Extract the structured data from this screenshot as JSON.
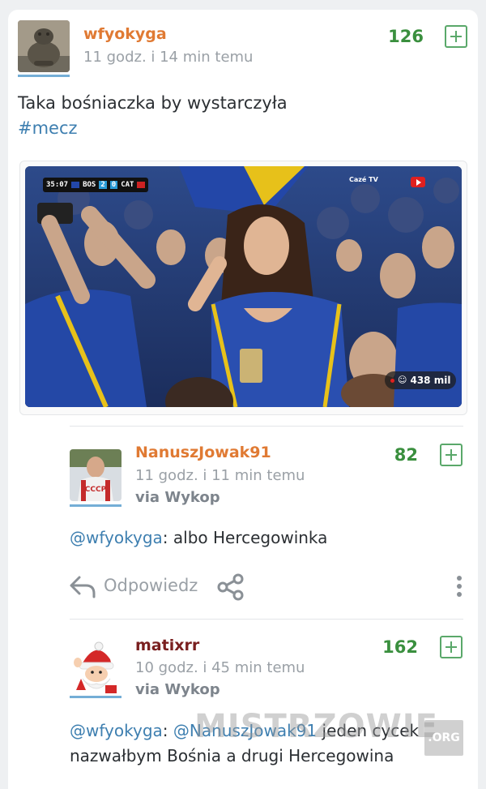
{
  "post": {
    "author": "wfyokyga",
    "time": "11 godz. i 14 min temu",
    "score": "126",
    "text": "Taka bośniaczka by wystarczyła",
    "tag": "#mecz",
    "media": {
      "scoreboard_time": "35:07",
      "team_home": "BOS",
      "score_home": "2",
      "score_away": "0",
      "team_away": "CAT",
      "broadcaster": "Cazé TV",
      "view_count": "438 mil"
    }
  },
  "comments": [
    {
      "author": "NanuszJowak91",
      "time": "11 godz. i 11 min temu",
      "via_label": "via",
      "via_app": "Wykop",
      "score": "82",
      "mention": "@wfyokyga",
      "text": ": albo Hercegowinka",
      "actions": {
        "reply_label": "Odpowiedz"
      }
    },
    {
      "author": "matixrr",
      "time": "10 godz. i 45 min temu",
      "via_label": "via",
      "via_app": "Wykop",
      "score": "162",
      "mention": "@wfyokyga",
      "text_part1": ": ",
      "mention2": "@NanuszJowak91",
      "text_part2": " jeden cycek",
      "text_line2": "nazwałbym Bośnia a drugi Hercegowina"
    }
  ],
  "watermark": {
    "text": "MISTRZOWIE",
    "suffix": ".ORG"
  },
  "colors": {
    "author_orange": "#e07a33",
    "author_maroon": "#7a2020",
    "score_green": "#3a8f3e",
    "mention_blue": "#3e7fb0"
  }
}
